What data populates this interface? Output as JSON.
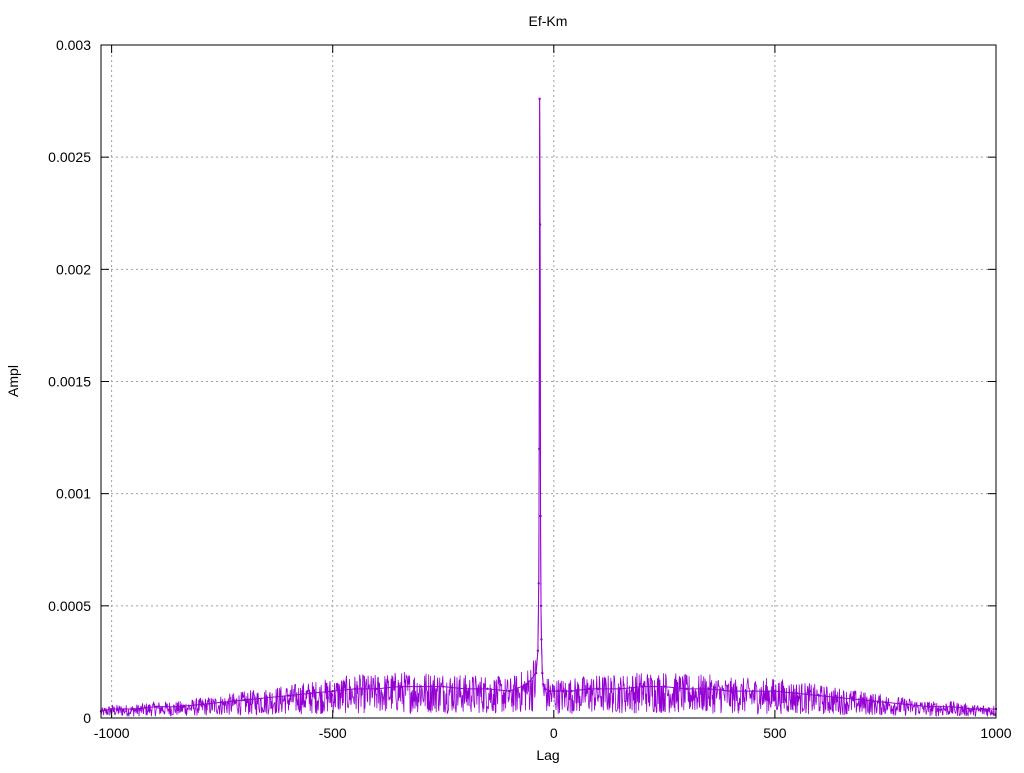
{
  "chart_data": {
    "type": "line",
    "title": "Ef-Km",
    "xlabel": "Lag",
    "ylabel": "Ampl",
    "xlim": [
      -1024,
      1000
    ],
    "ylim": [
      0,
      0.003
    ],
    "grid": true,
    "legend": "none",
    "x_ticks": [
      {
        "value": -1000,
        "label": "-1000"
      },
      {
        "value": -500,
        "label": "-500"
      },
      {
        "value": 0,
        "label": "0"
      },
      {
        "value": 500,
        "label": "500"
      },
      {
        "value": 1000,
        "label": "1000"
      }
    ],
    "y_ticks": [
      {
        "value": 0,
        "label": "0"
      },
      {
        "value": 0.0005,
        "label": "0.0005"
      },
      {
        "value": 0.001,
        "label": "0.001"
      },
      {
        "value": 0.0015,
        "label": "0.0015"
      },
      {
        "value": 0.002,
        "label": "0.002"
      },
      {
        "value": 0.0025,
        "label": "0.0025"
      },
      {
        "value": 0.003,
        "label": "0.003"
      }
    ],
    "series_color": "#9400d3",
    "series": [
      {
        "x": [
          -1024,
          -1000,
          -950,
          -900,
          -850,
          -800,
          -750,
          -700,
          -650,
          -600,
          -550,
          -500,
          -450,
          -400,
          -350,
          -300,
          -250,
          -200,
          -150,
          -100,
          -60,
          -40,
          -36,
          -34,
          -33,
          -32,
          -31,
          -30,
          -29,
          -28,
          -26,
          -24,
          -20,
          -10,
          0,
          10,
          20,
          40,
          80,
          100,
          150,
          200,
          250,
          300,
          350,
          400,
          450,
          500,
          550,
          600,
          650,
          700,
          750,
          800,
          850,
          900,
          950,
          1000
        ],
        "y": [
          3e-05,
          4e-05,
          4e-05,
          5e-05,
          5e-05,
          6e-05,
          7e-05,
          8e-05,
          9e-05,
          0.0001,
          0.00011,
          0.00012,
          0.00013,
          0.00013,
          0.00014,
          0.00014,
          0.00014,
          0.00013,
          0.00013,
          0.00012,
          0.00015,
          0.0002,
          0.0003,
          0.0006,
          0.0012,
          0.00276,
          0.0022,
          0.0009,
          0.0005,
          0.00035,
          0.0002,
          0.00015,
          0.00013,
          0.00012,
          0.00012,
          0.00012,
          0.00012,
          0.00012,
          0.00013,
          0.00013,
          0.00013,
          0.00014,
          0.00014,
          0.00013,
          0.00013,
          0.00012,
          0.00012,
          0.00012,
          0.00011,
          0.0001,
          9e-05,
          8e-05,
          7e-05,
          6e-05,
          5e-05,
          5e-05,
          4e-05,
          4e-05
        ]
      }
    ]
  }
}
